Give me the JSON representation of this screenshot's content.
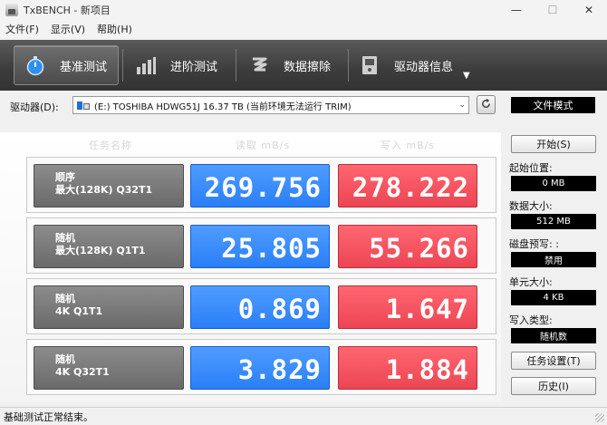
{
  "window": {
    "title": "TxBENCH - 新项目",
    "minimize": "—",
    "maximize": "☐",
    "close": "✕"
  },
  "menu": [
    "文件(F)",
    "显示(V)",
    "帮助(H)"
  ],
  "toolbar": {
    "tabs": [
      {
        "label": "基准测试",
        "icon": "stopwatch-icon",
        "active": true
      },
      {
        "label": "进阶测试",
        "icon": "bar-chart-icon",
        "active": false
      },
      {
        "label": "数据擦除",
        "icon": "eraser-icon",
        "active": false
      },
      {
        "label": "驱动器信息",
        "icon": "drive-info-icon",
        "active": false
      }
    ],
    "more": "▼"
  },
  "drive": {
    "label": "驱动器(D):",
    "selected": "(E:) TOSHIBA HDWG51J  16.37 TB (当前环境无法运行 TRIM)",
    "mode": "文件模式"
  },
  "results": {
    "headers": {
      "task": "任务名称",
      "read": "读取 mB/s",
      "write": "写入 mB/s"
    },
    "rows": [
      {
        "line1": "顺序",
        "line2": "最大(128K) Q32T1",
        "read": "269.756",
        "write": "278.222"
      },
      {
        "line1": "随机",
        "line2": "最大(128K) Q1T1",
        "read": "25.805",
        "write": "55.266"
      },
      {
        "line1": "随机",
        "line2": "4K Q1T1",
        "read": "0.869",
        "write": "1.647"
      },
      {
        "line1": "随机",
        "line2": "4K Q32T1",
        "read": "3.829",
        "write": "1.884"
      }
    ]
  },
  "side": {
    "start": "开始(S)",
    "start_pos_label": "起始位置:",
    "start_pos": "0 MB",
    "data_size_label": "数据大小:",
    "data_size": "512 MB",
    "precondition_label": "磁盘预写: :",
    "precondition": "禁用",
    "unit_size_label": "单元大小:",
    "unit_size": "4 KB",
    "write_type_label": "写入类型:",
    "write_type": "随机数",
    "task_settings": "任务设置(T)",
    "history": "历史(I)"
  },
  "status": "基础测试正常结束。",
  "colors": {
    "read": "#2a7ff7",
    "write": "#ec4554",
    "toolbar": "#3c3c3c"
  }
}
